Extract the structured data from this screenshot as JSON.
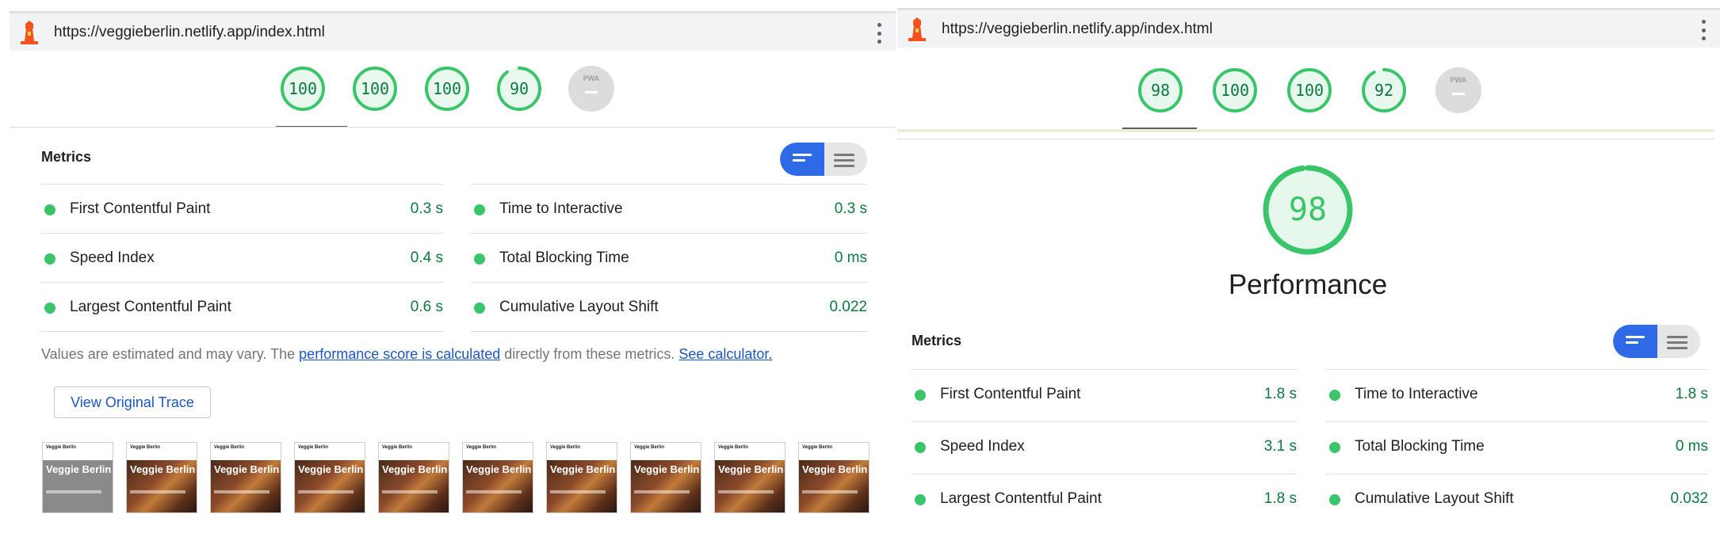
{
  "left": {
    "url": "https://veggieberlin.netlify.app/index.html",
    "gauges": [
      {
        "value": "100",
        "score": 1.0
      },
      {
        "value": "100",
        "score": 1.0
      },
      {
        "value": "100",
        "score": 1.0
      },
      {
        "value": "90",
        "score": 0.9
      }
    ],
    "pwa_label": "PWA",
    "metrics_title": "Metrics",
    "metrics_left": [
      {
        "label": "First Contentful Paint",
        "value": "0.3 s"
      },
      {
        "label": "Speed Index",
        "value": "0.4 s"
      },
      {
        "label": "Largest Contentful Paint",
        "value": "0.6 s"
      }
    ],
    "metrics_right": [
      {
        "label": "Time to Interactive",
        "value": "0.3 s"
      },
      {
        "label": "Total Blocking Time",
        "value": "0 ms"
      },
      {
        "label": "Cumulative Layout Shift",
        "value": "0.022"
      }
    ],
    "note_prefix": "Values are estimated and may vary. The ",
    "note_link1": "performance score is calculated",
    "note_middle": " directly from these metrics. ",
    "note_link2": "See calculator.",
    "trace_button": "View Original Trace",
    "filmstrip_brand": "Veggie Berlin",
    "filmstrip_title": "Veggie Berlin"
  },
  "right": {
    "url": "https://veggieberlin.netlify.app/index.html",
    "gauges": [
      {
        "value": "98",
        "score": 0.98
      },
      {
        "value": "100",
        "score": 1.0
      },
      {
        "value": "100",
        "score": 1.0
      },
      {
        "value": "92",
        "score": 0.92
      }
    ],
    "pwa_label": "PWA",
    "big_score": "98",
    "big_score_fraction": 0.98,
    "category_title": "Performance",
    "metrics_title": "Metrics",
    "metrics_left": [
      {
        "label": "First Contentful Paint",
        "value": "1.8 s"
      },
      {
        "label": "Speed Index",
        "value": "3.1 s"
      },
      {
        "label": "Largest Contentful Paint",
        "value": "1.8 s"
      }
    ],
    "metrics_right": [
      {
        "label": "Time to Interactive",
        "value": "1.8 s"
      },
      {
        "label": "Total Blocking Time",
        "value": "0 ms"
      },
      {
        "label": "Cumulative Layout Shift",
        "value": "0.032"
      }
    ]
  },
  "colors": {
    "pass_green": "#3bc56b",
    "pass_text": "#0c7a3e",
    "toggle_blue": "#2f6ae6",
    "link_blue": "#1a56c5"
  },
  "icons": {
    "lighthouse": "lighthouse-icon",
    "menu": "kebab-menu-icon"
  }
}
